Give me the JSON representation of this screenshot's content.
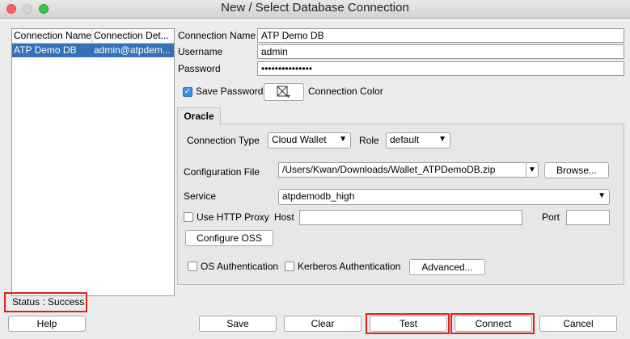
{
  "window": {
    "title": "New / Select Database Connection"
  },
  "connections": {
    "headers": [
      "Connection Name",
      "Connection Det..."
    ],
    "rows": [
      {
        "name": "ATP Demo DB",
        "details": "admin@atpdem..."
      }
    ]
  },
  "form": {
    "connection_name_label": "Connection Name",
    "connection_name_value": "ATP Demo DB",
    "username_label": "Username",
    "username_value": "admin",
    "password_label": "Password",
    "password_value": "•••••••••••••••",
    "save_password_label": "Save Password",
    "save_password_checked": true,
    "connection_color_label": "Connection Color"
  },
  "tabs": [
    "Oracle"
  ],
  "oracle": {
    "connection_type_label": "Connection Type",
    "connection_type_value": "Cloud Wallet",
    "role_label": "Role",
    "role_value": "default",
    "config_file_label": "Configuration File",
    "config_file_value": "/Users/Kwan/Downloads/Wallet_ATPDemoDB.zip",
    "browse_label": "Browse...",
    "service_label": "Service",
    "service_value": "atpdemodb_high",
    "use_http_proxy_label": "Use HTTP Proxy",
    "host_label": "Host",
    "port_label": "Port",
    "configure_oss_label": "Configure OSS",
    "os_auth_label": "OS Authentication",
    "kerberos_auth_label": "Kerberos Authentication",
    "advanced_label": "Advanced..."
  },
  "status": {
    "text": "Status : Success"
  },
  "buttons": {
    "help": "Help",
    "save": "Save",
    "clear": "Clear",
    "test": "Test",
    "connect": "Connect",
    "cancel": "Cancel"
  },
  "colors": {
    "selection": "#3571b8",
    "highlight": "#e0201b",
    "checkbox": "#3c8ee0"
  }
}
